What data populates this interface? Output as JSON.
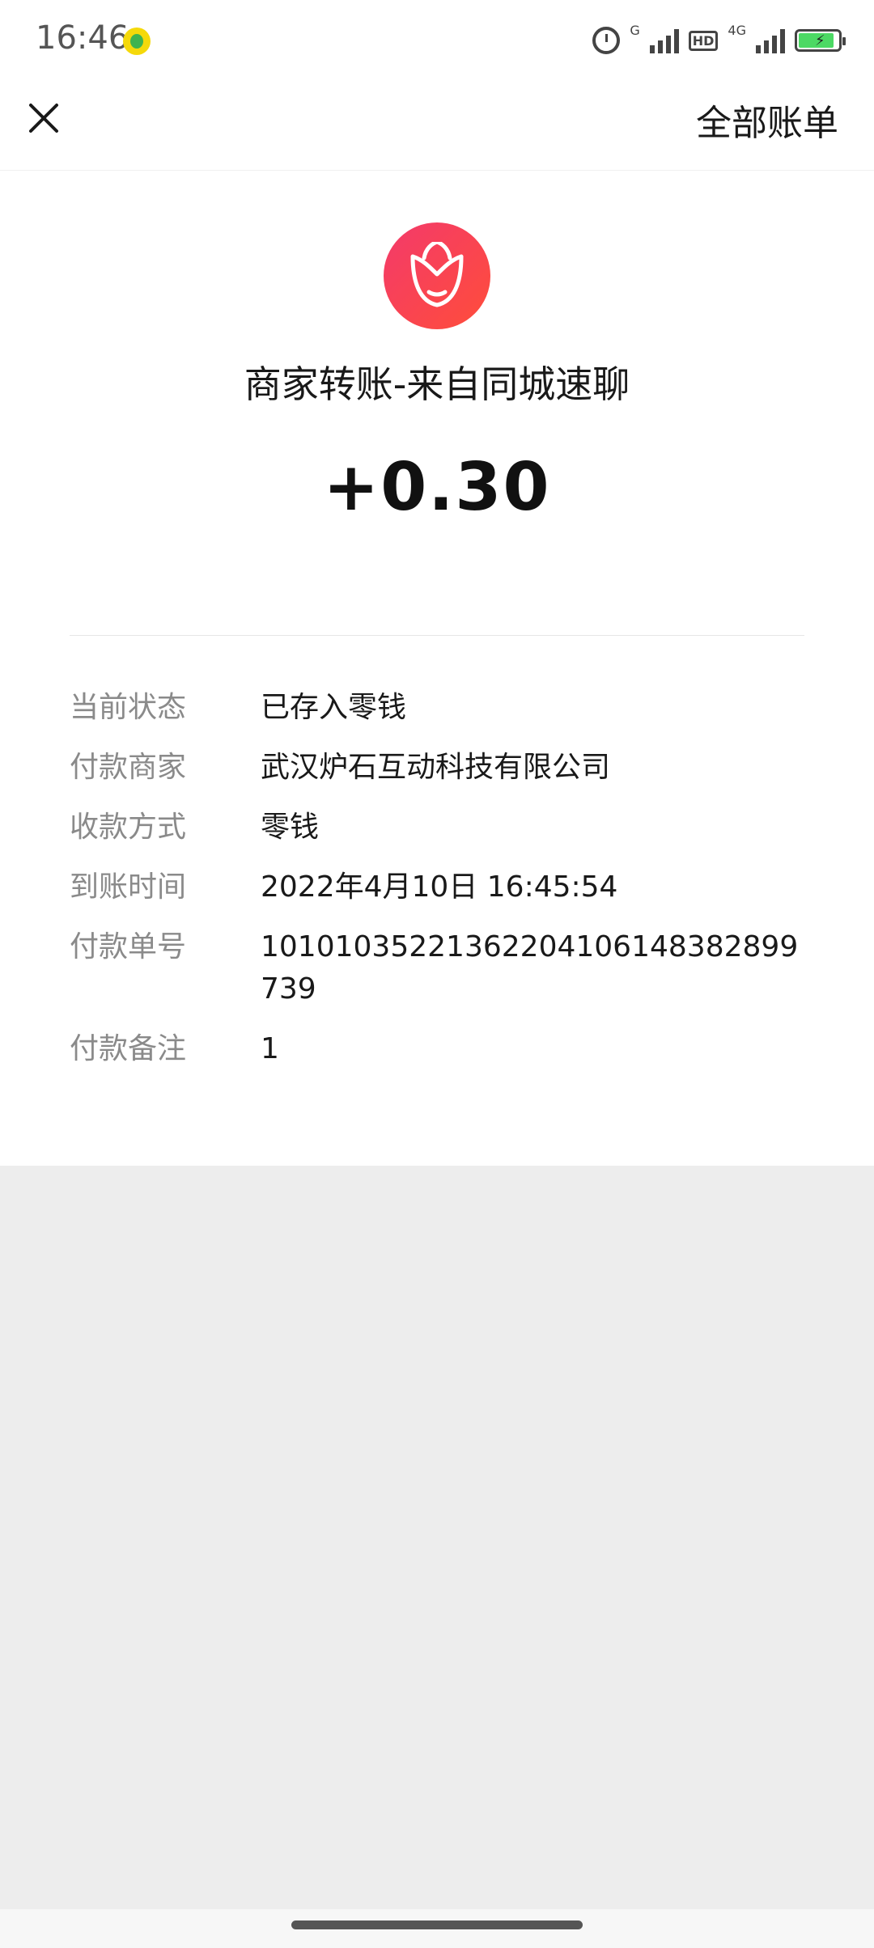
{
  "status_bar": {
    "time": "16:46",
    "network_1": "G",
    "network_2": "4G",
    "hd_label": "HD",
    "battery_level": 0.9
  },
  "nav": {
    "all_bills_label": "全部账单"
  },
  "transaction": {
    "title": "商家转账-来自同城速聊",
    "amount": "+0.30",
    "brand_color": "#f33a6b"
  },
  "details": [
    {
      "label": "当前状态",
      "value": "已存入零钱"
    },
    {
      "label": "付款商家",
      "value": "武汉炉石互动科技有限公司"
    },
    {
      "label": "收款方式",
      "value": "零钱"
    },
    {
      "label": "到账时间",
      "value": "2022年4月10日 16:45:54"
    },
    {
      "label": "付款单号",
      "value": "10101035221362204106148382899739"
    },
    {
      "label": "付款备注",
      "value": "1"
    }
  ]
}
